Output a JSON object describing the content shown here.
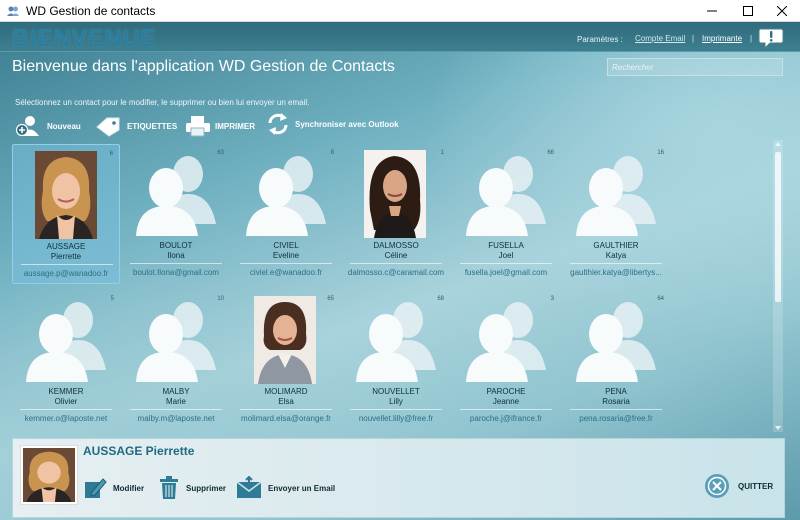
{
  "window": {
    "title": "WD Gestion de contacts"
  },
  "header": {
    "banner": "BIENVENUE",
    "params_label": "Paramètres :",
    "email_link": "Compte Email",
    "separator": "|",
    "print_link": "Imprimante"
  },
  "main": {
    "heading": "Bienvenue dans l'application WD Gestion de Contacts",
    "search_placeholder": "Rechercher",
    "instructions": "Sélectionnez un contact pour le modifier, le supprimer ou bien lui envoyer un email."
  },
  "toolbar": {
    "new_label": "Nouveau",
    "labels_label": "ETIQUETTES",
    "print_label": "IMPRIMER",
    "sync_label": "Synchroniser avec Outlook"
  },
  "contacts": [
    {
      "last": "AUSSAGE",
      "first": "Pierrette",
      "email": "aussage.p@wanadoo.fr",
      "count": "6",
      "photo": "blonde-woman",
      "selected": true
    },
    {
      "last": "BOULOT",
      "first": "Ilona",
      "email": "boulot.Ilona@gmail.com",
      "count": "63",
      "photo": "none"
    },
    {
      "last": "CIVIEL",
      "first": "Eveline",
      "email": "civiel.e@wanadoo.fr",
      "count": "8",
      "photo": "none"
    },
    {
      "last": "DALMOSSO",
      "first": "Céline",
      "email": "dalmosso.c@caramail.com",
      "count": "1",
      "photo": "brunette-woman"
    },
    {
      "last": "FUSELLA",
      "first": "Joel",
      "email": "fusella.joel@gmail.com",
      "count": "66",
      "photo": "none"
    },
    {
      "last": "GAULTHIER",
      "first": "Katya",
      "email": "gaulthier.katya@libertys...",
      "count": "16",
      "photo": "none"
    },
    {
      "last": "KEMMER",
      "first": "Olivier",
      "email": "kemmer.o@laposte.net",
      "count": "5",
      "photo": "none"
    },
    {
      "last": "MALBY",
      "first": "Marie",
      "email": "malby.m@laposte.net",
      "count": "10",
      "photo": "none"
    },
    {
      "last": "MOLIMARD",
      "first": "Elsa",
      "email": "molimard.elsa@orange.fr",
      "count": "65",
      "photo": "businesswoman"
    },
    {
      "last": "NOUVELLET",
      "first": "Lilly",
      "email": "nouvellet.lilly@free.fr",
      "count": "68",
      "photo": "none"
    },
    {
      "last": "PAROCHE",
      "first": "Jeanne",
      "email": "paroche.j@ifrance.fr",
      "count": "3",
      "photo": "none"
    },
    {
      "last": "PENA",
      "first": "Rosaria",
      "email": "pena.rosaria@free.fr",
      "count": "64",
      "photo": "none"
    }
  ],
  "detail": {
    "selected_name": "AUSSAGE Pierrette",
    "edit_label": "Modifier",
    "delete_label": "Supprimer",
    "email_label": "Envoyer un Email",
    "quit_label": "QUITTER"
  },
  "colors": {
    "accent": "#1f6a84",
    "selection": "#8fd0ea"
  }
}
